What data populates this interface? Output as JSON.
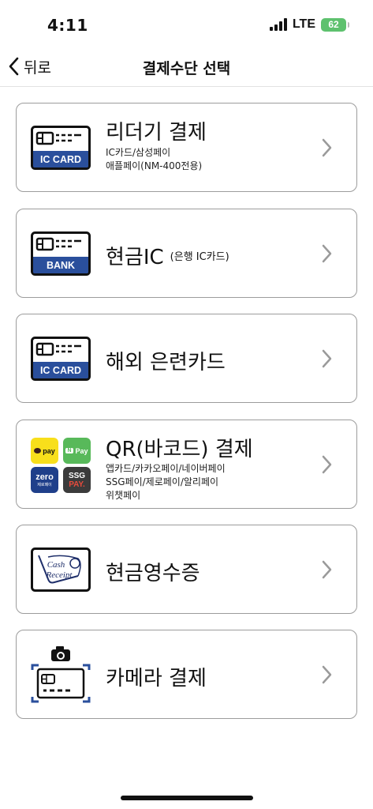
{
  "status_bar": {
    "time": "4:11",
    "network": "LTE",
    "battery": "62"
  },
  "nav": {
    "back_label": "뒤로",
    "title": "결제수단 선택"
  },
  "options": [
    {
      "title": "리더기 결제",
      "subtitle_lines": [
        "IC카드/삼성페이",
        "애플페이(NM-400전용)"
      ],
      "icon": "ic-card-icon",
      "icon_label": "IC CARD"
    },
    {
      "title": "현금IC",
      "note": "(은행 IC카드)",
      "icon": "bank-card-icon",
      "icon_label": "BANK"
    },
    {
      "title": "해외 은련카드",
      "icon": "ic-card-icon",
      "icon_label": "IC CARD"
    },
    {
      "title": "QR(바코드) 결제",
      "subtitle_lines": [
        "앱카드/카카오페이/네이버페이",
        "SSG페이/제로페이/알리페이",
        "위챗페이"
      ],
      "icon": "qr-pay-logos-icon",
      "pay_logos": {
        "kakao": "pay",
        "naver_n": "N",
        "naver": "Pay",
        "zero": "zero",
        "zero_sub": "제로페이",
        "ssg": "SSG",
        "ssg_pay": "PAY."
      }
    },
    {
      "title": "현금영수증",
      "icon": "cash-receipt-icon",
      "icon_label_top": "Cash",
      "icon_label_bottom": "Receipt"
    },
    {
      "title": "카메라 결제",
      "icon": "camera-card-icon"
    }
  ],
  "colors": {
    "card_blue": "#2a4f9c",
    "kakao_yellow": "#f8df1b",
    "naver_green": "#58b95a",
    "zero_navy": "#1f3f8a",
    "ssg_dark": "#3b3b3b",
    "ssg_red": "#e84b3c",
    "battery_green": "#5ec16e"
  }
}
